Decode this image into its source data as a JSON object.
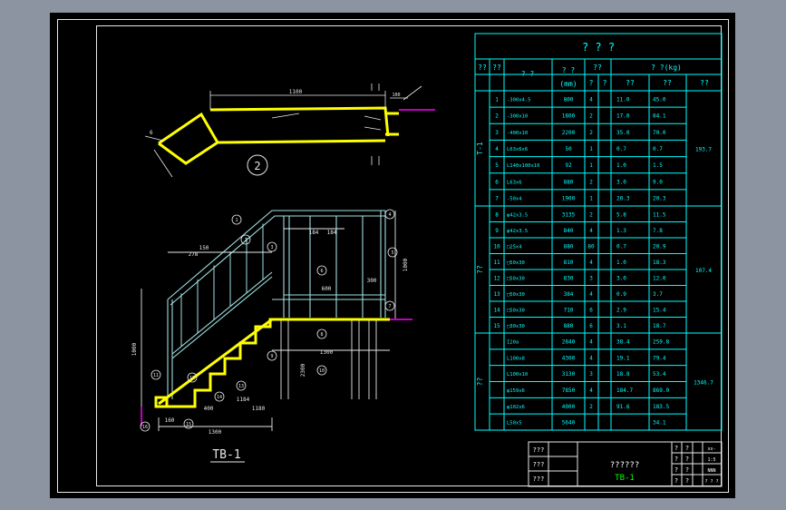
{
  "colors": {
    "background": "#8c94a1",
    "sheet": "#000000",
    "frame": "#e8e8e8",
    "table": "#00ffff",
    "yellow": "#ffff00",
    "drawing": "#9fdfe0",
    "magenta": "#c000c0",
    "white": "#ffffff",
    "green": "#00ff00"
  },
  "table": {
    "title": "?   ?   ?",
    "header": {
      "col1": "??",
      "col2": "??",
      "col3": "? ?",
      "col4": "? ?",
      "col4_unit": "(mm)",
      "col5": "??",
      "col5a": "?",
      "col5b": "?",
      "weight_group": "? ?(kg)",
      "weight_a": "??",
      "weight_b": "??",
      "weight_c": "??"
    },
    "groups": [
      {
        "label": "T-1",
        "total": "193.7",
        "rows": [
          {
            "no": "1",
            "spec": "-300x4.5",
            "len": "800",
            "qty": "4",
            "unit": "11.0",
            "sum": "45.0"
          },
          {
            "no": "2",
            "spec": "-300x10",
            "len": "1800",
            "qty": "2",
            "unit": "17.0",
            "sum": "84.1"
          },
          {
            "no": "3",
            "spec": "-400x10",
            "len": "2200",
            "qty": "2",
            "unit": "35.0",
            "sum": "70.0"
          },
          {
            "no": "4",
            "spec": "L63x6x6",
            "len": "50",
            "qty": "1",
            "unit": "0.7",
            "sum": "0.7"
          },
          {
            "no": "5",
            "spec": "L140x100x10",
            "len": "92",
            "qty": "1",
            "unit": "1.0",
            "sum": "1.5"
          },
          {
            "no": "6",
            "spec": "L63x6",
            "len": "880",
            "qty": "2",
            "unit": "3.0",
            "sum": "9.0"
          },
          {
            "no": "7",
            "spec": "-50x4",
            "len": "1900",
            "qty": "1",
            "unit": "20.3",
            "sum": "20.3"
          }
        ]
      },
      {
        "label": "??",
        "total": "107.4",
        "rows": [
          {
            "no": "8",
            "spec": "φ42x3.5",
            "len": "3135",
            "qty": "2",
            "unit": "5.8",
            "sum": "11.5"
          },
          {
            "no": "9",
            "spec": "φ42x3.5",
            "len": "840",
            "qty": "4",
            "unit": "1.3",
            "sum": "7.8"
          },
          {
            "no": "10",
            "spec": "□25x4",
            "len": "880",
            "qty": "80",
            "unit": "0.7",
            "sum": "20.9"
          },
          {
            "no": "11",
            "spec": "□50x30",
            "len": "810",
            "qty": "4",
            "unit": "1.0",
            "sum": "18.3"
          },
          {
            "no": "12",
            "spec": "□50x30",
            "len": "830",
            "qty": "3",
            "unit": "3.0",
            "sum": "12.0"
          },
          {
            "no": "13",
            "spec": "□50x30",
            "len": "384",
            "qty": "4",
            "unit": "0.9",
            "sum": "3.7"
          },
          {
            "no": "14",
            "spec": "□50x30",
            "len": "710",
            "qty": "6",
            "unit": "2.9",
            "sum": "15.4"
          },
          {
            "no": "15",
            "spec": "□30x30",
            "len": "880",
            "qty": "6",
            "unit": "3.1",
            "sum": "18.7"
          }
        ]
      },
      {
        "label": "??",
        "total": "1346.7",
        "rows": [
          {
            "no": "",
            "spec": "I20a",
            "len": "2840",
            "qty": "4",
            "unit": "38.4",
            "sum": "259.8"
          },
          {
            "no": "",
            "spec": "L100x8",
            "len": "4300",
            "qty": "4",
            "unit": "19.1",
            "sum": "79.4"
          },
          {
            "no": "",
            "spec": "L100x10",
            "len": "3130",
            "qty": "3",
            "unit": "18.8",
            "sum": "53.4"
          },
          {
            "no": "",
            "spec": "φ159x6",
            "len": "7850",
            "qty": "4",
            "unit": "184.7",
            "sum": "869.0"
          },
          {
            "no": "",
            "spec": "φ102x6",
            "len": "4000",
            "qty": "2",
            "unit": "91.6",
            "sum": "183.5"
          },
          {
            "no": "",
            "spec": "L50x5",
            "len": "5640",
            "qty": "",
            "unit": "",
            "sum": "34.1"
          }
        ]
      }
    ]
  },
  "title_block": {
    "left_labels": [
      "???",
      "???",
      "???"
    ],
    "center_title": "??????",
    "drawing_code": "TB-1",
    "right_labels": [
      [
        "?",
        "?",
        "???"
      ],
      [
        "?",
        "?",
        "1:5"
      ],
      [
        "?",
        "?",
        "A3"
      ],
      [
        "?",
        "?",
        "? ? ?"
      ]
    ],
    "right_values": [
      "xx-",
      "1:5",
      "NNN",
      "? ? ?"
    ]
  },
  "section_view": {
    "label": "2",
    "dim_top": "1100",
    "dim_right": "100",
    "annotation": "6"
  },
  "elevation_view": {
    "title": "TB-1",
    "dims": {
      "bottom": "1300",
      "left_height": "1000",
      "right_height": "1000",
      "step": "160",
      "width2": "1180",
      "seg": "150",
      "seg2": "1184",
      "mid": "600",
      "mid2": "1300",
      "post": "2300",
      "bar": "184",
      "bar2": "184",
      "b300": "300",
      "b400": "400",
      "b278": "278"
    },
    "callouts": [
      "1",
      "2",
      "3",
      "4",
      "5",
      "6",
      "7",
      "8",
      "9",
      "10",
      "11",
      "12",
      "13",
      "14",
      "15",
      "16"
    ]
  }
}
